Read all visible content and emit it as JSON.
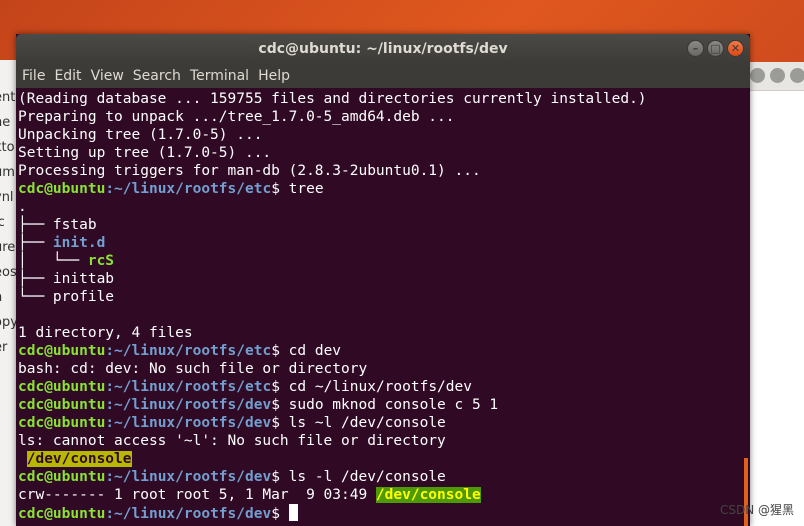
{
  "window": {
    "title": "cdc@ubuntu: ~/linux/rootfs/dev",
    "buttons": {
      "minimize": "–",
      "maximize": "□",
      "close": "✕"
    }
  },
  "menu": [
    "File",
    "Edit",
    "View",
    "Search",
    "Terminal",
    "Help"
  ],
  "background_left_fragments": [
    "",
    "enti",
    "he",
    "kto",
    "um",
    "ynl",
    "ic",
    "ure",
    "eos",
    "h",
    "opy",
    "er"
  ],
  "terminal": {
    "prompt_user": "cdc@ubuntu",
    "lines": [
      {
        "type": "text",
        "text": "(Reading database ... 159755 files and directories currently installed.)"
      },
      {
        "type": "text",
        "text": "Preparing to unpack .../tree_1.7.0-5_amd64.deb ..."
      },
      {
        "type": "text",
        "text": "Unpacking tree (1.7.0-5) ..."
      },
      {
        "type": "text",
        "text": "Setting up tree (1.7.0-5) ..."
      },
      {
        "type": "text",
        "text": "Processing triggers for man-db (2.8.3-2ubuntu0.1) ..."
      },
      {
        "type": "prompt",
        "path": ":~/linux/rootfs/etc",
        "cmd": "$ tree"
      },
      {
        "type": "text",
        "text": "."
      },
      {
        "type": "tree",
        "prefix": "├── ",
        "name": "fstab",
        "style": "plain"
      },
      {
        "type": "tree",
        "prefix": "├── ",
        "name": "init.d",
        "style": "dir"
      },
      {
        "type": "tree",
        "prefix": "│   └── ",
        "name": "rcS",
        "style": "exe"
      },
      {
        "type": "tree",
        "prefix": "├── ",
        "name": "inittab",
        "style": "plain"
      },
      {
        "type": "tree",
        "prefix": "└── ",
        "name": "profile",
        "style": "plain"
      },
      {
        "type": "text",
        "text": ""
      },
      {
        "type": "text",
        "text": "1 directory, 4 files"
      },
      {
        "type": "prompt",
        "path": ":~/linux/rootfs/etc",
        "cmd": "$ cd dev"
      },
      {
        "type": "text",
        "text": "bash: cd: dev: No such file or directory"
      },
      {
        "type": "prompt",
        "path": ":~/linux/rootfs/etc",
        "cmd": "$ cd ~/linux/rootfs/dev"
      },
      {
        "type": "prompt",
        "path": ":~/linux/rootfs/dev",
        "cmd": "$ sudo mknod console c 5 1"
      },
      {
        "type": "prompt",
        "path": ":~/linux/rootfs/dev",
        "cmd": "$ ls ~l /dev/console"
      },
      {
        "type": "text",
        "text": "ls: cannot access '~l': No such file or directory"
      },
      {
        "type": "devline",
        "prefix": " ",
        "name": "/dev/console",
        "style": "dev"
      },
      {
        "type": "prompt",
        "path": ":~/linux/rootfs/dev",
        "cmd": "$ ls -l /dev/console"
      },
      {
        "type": "devline",
        "prefix": "crw------- 1 root root 5, 1 Mar  9 03:49 ",
        "name": "/dev/console",
        "style": "dev2"
      },
      {
        "type": "prompt",
        "path": ":~/linux/rootfs/dev",
        "cmd": "$ ",
        "cursor": true
      }
    ]
  },
  "watermark": "CSDN @猩黑"
}
